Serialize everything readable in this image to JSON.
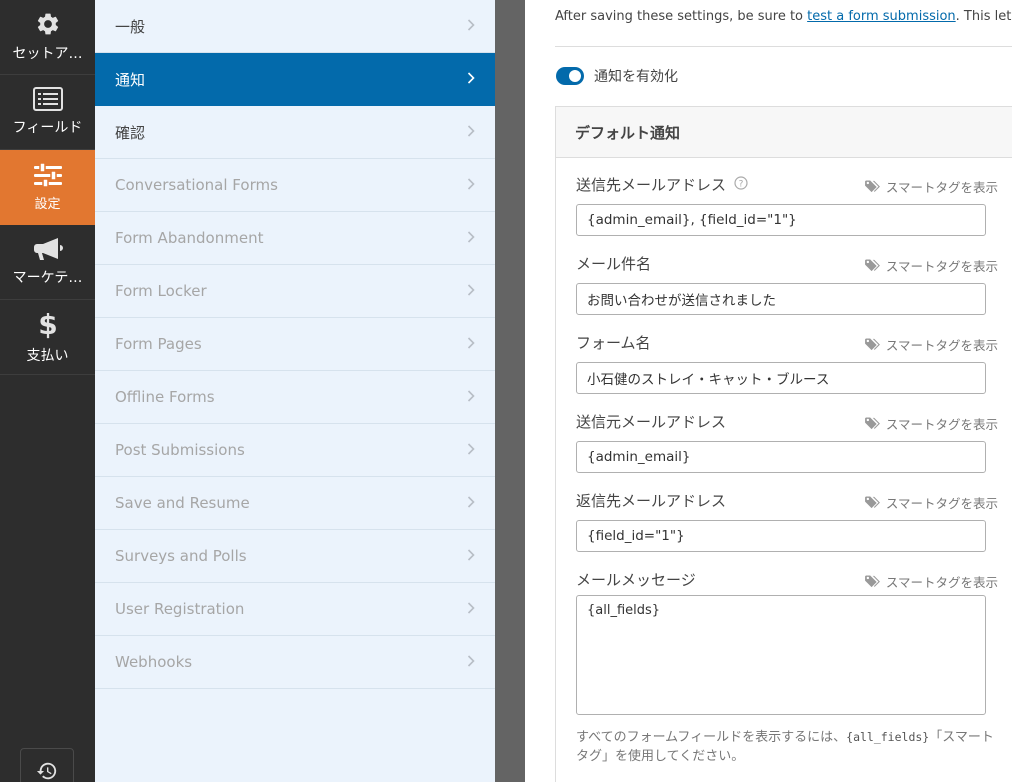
{
  "rail": {
    "items": [
      {
        "label": "セットア…",
        "icon": "gear-icon"
      },
      {
        "label": "フィールド",
        "icon": "fields-list-icon"
      },
      {
        "label": "設定",
        "icon": "sliders-icon"
      },
      {
        "label": "マーケテ…",
        "icon": "megaphone-icon"
      },
      {
        "label": "支払い",
        "icon": "dollar-icon"
      }
    ],
    "bottom_icon": "revisions-history-icon",
    "active_color": "#e27730"
  },
  "sections": {
    "items": [
      {
        "label": "一般"
      },
      {
        "label": "通知"
      },
      {
        "label": "確認"
      },
      {
        "label": "Conversational Forms"
      },
      {
        "label": "Form Abandonment"
      },
      {
        "label": "Form Locker"
      },
      {
        "label": "Form Pages"
      },
      {
        "label": "Offline Forms"
      },
      {
        "label": "Post Submissions"
      },
      {
        "label": "Save and Resume"
      },
      {
        "label": "Surveys and Polls"
      },
      {
        "label": "User Registration"
      },
      {
        "label": "Webhooks"
      }
    ],
    "active_index": 1,
    "active_color": "#036aab"
  },
  "main": {
    "intro_before": "After saving these settings, be sure to ",
    "intro_link": "test a form submission",
    "intro_after": ". This lets you",
    "toggle_label": "通知を有効化",
    "toggle_on": true,
    "notification_title": "デフォルト通知",
    "smart_tag_label": "スマートタグを表示",
    "fields": [
      {
        "label": "送信先メールアドレス",
        "value": "{admin_email}, {field_id=\"1\"}"
      },
      {
        "label": "メール件名",
        "value": "お問い合わせが送信されました"
      },
      {
        "label": "フォーム名",
        "value": "小石健のストレイ・キャット・ブルース"
      },
      {
        "label": "送信元メールアドレス",
        "value": "{admin_email}"
      },
      {
        "label": "返信先メールアドレス",
        "value": "{field_id=\"1\"}"
      }
    ],
    "message": {
      "label": "メールメッセージ",
      "value": "{all_fields}"
    },
    "hint_before": "すべてのフォームフィールドを表示するには、",
    "hint_code": "{all_fields}",
    "hint_after": "「スマートタグ」を使用してください。"
  }
}
